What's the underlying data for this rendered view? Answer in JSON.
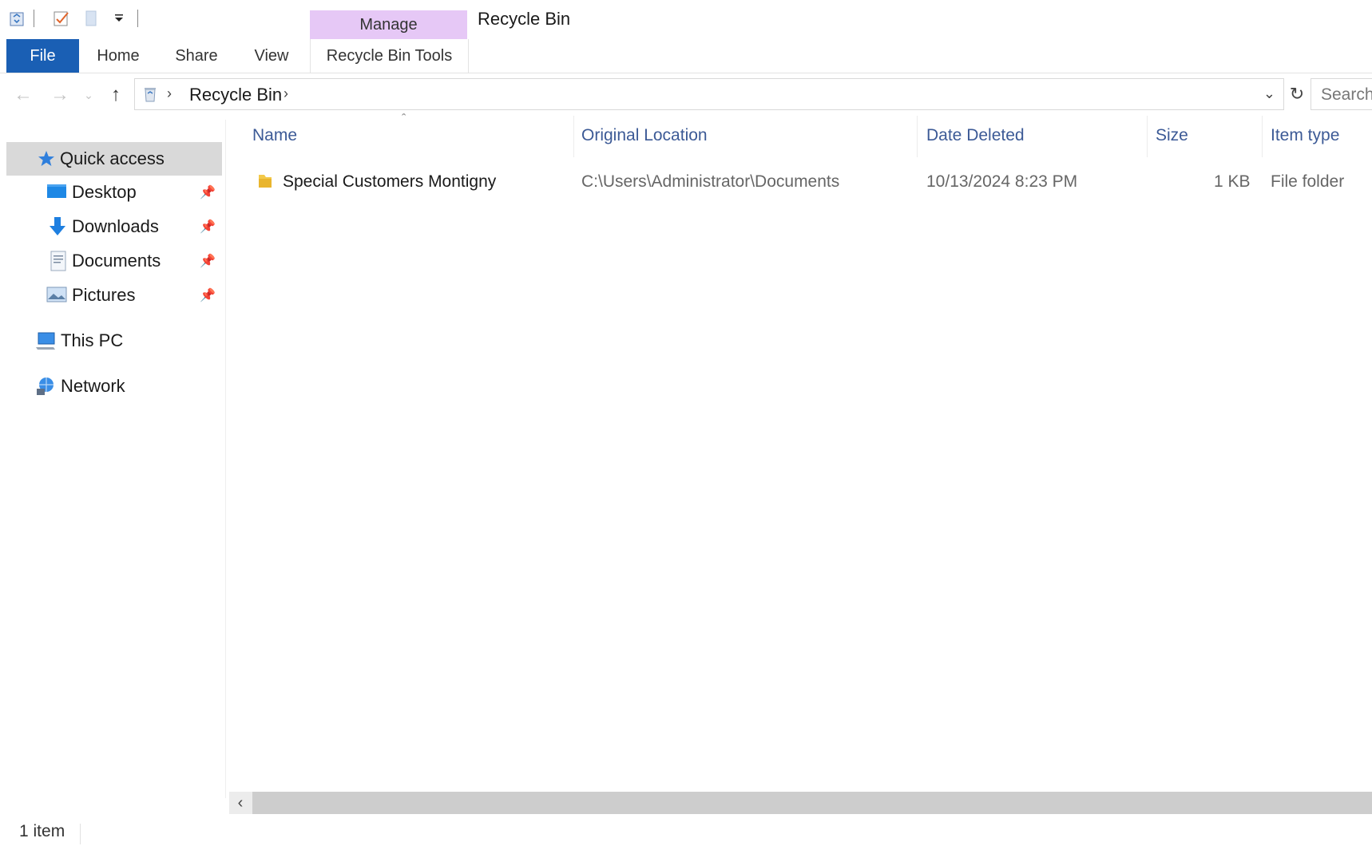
{
  "window": {
    "title": "Recycle Bin"
  },
  "quick_access_toolbar": {
    "icons": [
      "recycle-bin-icon",
      "properties-check-icon",
      "new-folder-icon",
      "customize-dropdown-icon"
    ]
  },
  "ribbon": {
    "contextual_group": "Manage",
    "tabs": [
      "File",
      "Home",
      "Share",
      "View",
      "Recycle Bin Tools"
    ]
  },
  "address_bar": {
    "breadcrumbs": [
      "Recycle Bin"
    ],
    "search_placeholder": "Search"
  },
  "nav_pane": {
    "quick_access": {
      "label": "Quick access",
      "icon": "star-icon"
    },
    "pinned": [
      {
        "label": "Desktop",
        "icon": "desktop-icon"
      },
      {
        "label": "Downloads",
        "icon": "download-arrow-icon"
      },
      {
        "label": "Documents",
        "icon": "documents-icon"
      },
      {
        "label": "Pictures",
        "icon": "pictures-icon"
      }
    ],
    "this_pc": {
      "label": "This PC",
      "icon": "computer-icon"
    },
    "network": {
      "label": "Network",
      "icon": "network-icon"
    }
  },
  "file_list": {
    "columns": [
      "Name",
      "Original Location",
      "Date Deleted",
      "Size",
      "Item type"
    ],
    "rows": [
      {
        "name": "Special Customers Montigny",
        "original_location": "C:\\Users\\Administrator\\Documents",
        "date_deleted": "10/13/2024 8:23 PM",
        "size": "1 KB",
        "item_type": "File folder",
        "icon": "folder-icon"
      }
    ]
  },
  "status_bar": {
    "item_count": "1 item"
  },
  "colors": {
    "file_tab": "#1a5fb4",
    "manage_tab": "#e6c8f6",
    "header_text": "#3c5a96"
  }
}
